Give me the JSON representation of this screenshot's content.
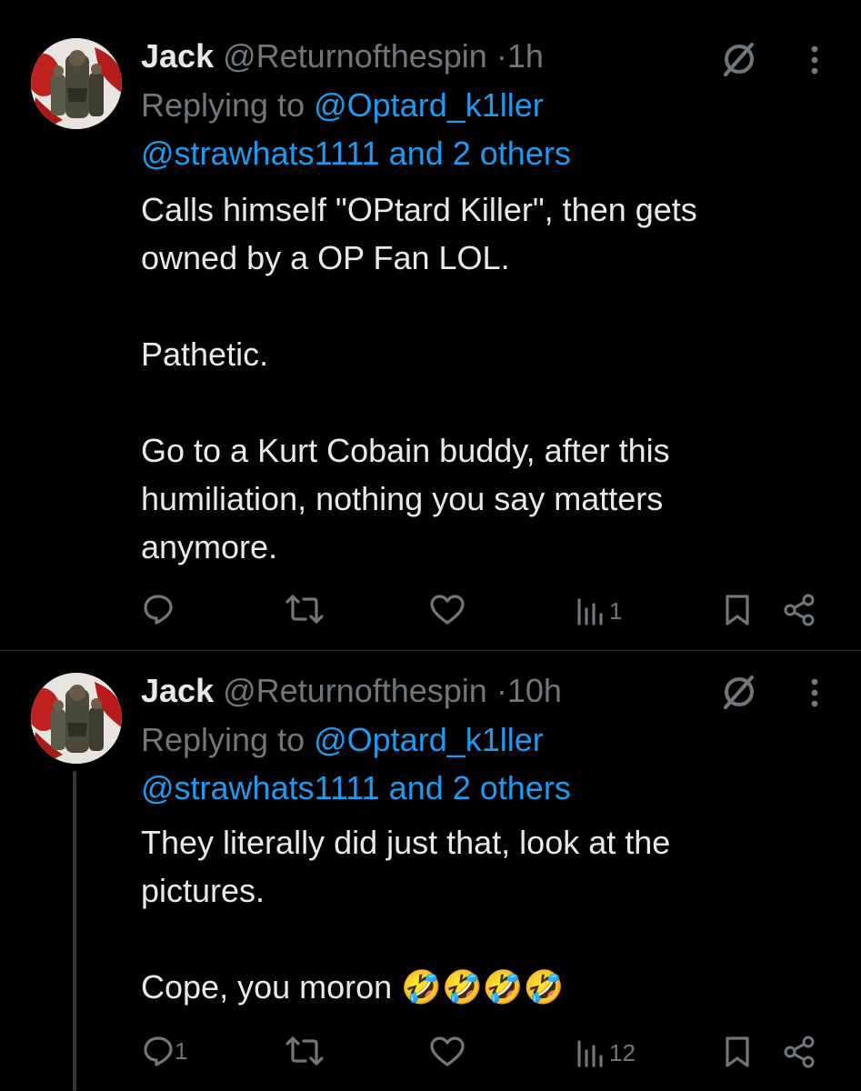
{
  "tweets": [
    {
      "name": "Jack",
      "handle": "@Returnofthespin",
      "sep": "·",
      "time": "1h",
      "replying_prefix": "Replying to ",
      "reply_to": "@Optard_k1ller",
      "reply_others": "@strawhats1111 and 2 others",
      "text": "Calls himself \"OPtard Killer\", then gets\nowned by a OP Fan LOL.\n\nPathetic.\n\nGo to a Kurt Cobain buddy, after this\nhumiliation, nothing you say matters\nanymore.",
      "replies": "",
      "reposts": "",
      "likes": "",
      "views": "1"
    },
    {
      "name": "Jack",
      "handle": "@Returnofthespin",
      "sep": "·",
      "time": "10h",
      "replying_prefix": "Replying to ",
      "reply_to": "@Optard_k1ller",
      "reply_others": "@strawhats1111 and 2 others",
      "text": "They literally did just that, look at the\npictures.\n\nCope, you moron 🤣🤣🤣🤣",
      "replies": "1",
      "reposts": "",
      "likes": "",
      "views": "12"
    }
  ],
  "icons": {
    "grok": "grok-slash-icon",
    "more": "more-vertical-icon",
    "reply": "reply-bubble-icon",
    "repost": "repost-icon",
    "like": "heart-icon",
    "views": "views-bar-icon",
    "bookmark": "bookmark-icon",
    "share": "share-icon"
  },
  "colors": {
    "background": "#000000",
    "text": "#e7e9ea",
    "muted": "#71767b",
    "link": "#1d9bf0",
    "divider": "#2f3336"
  }
}
